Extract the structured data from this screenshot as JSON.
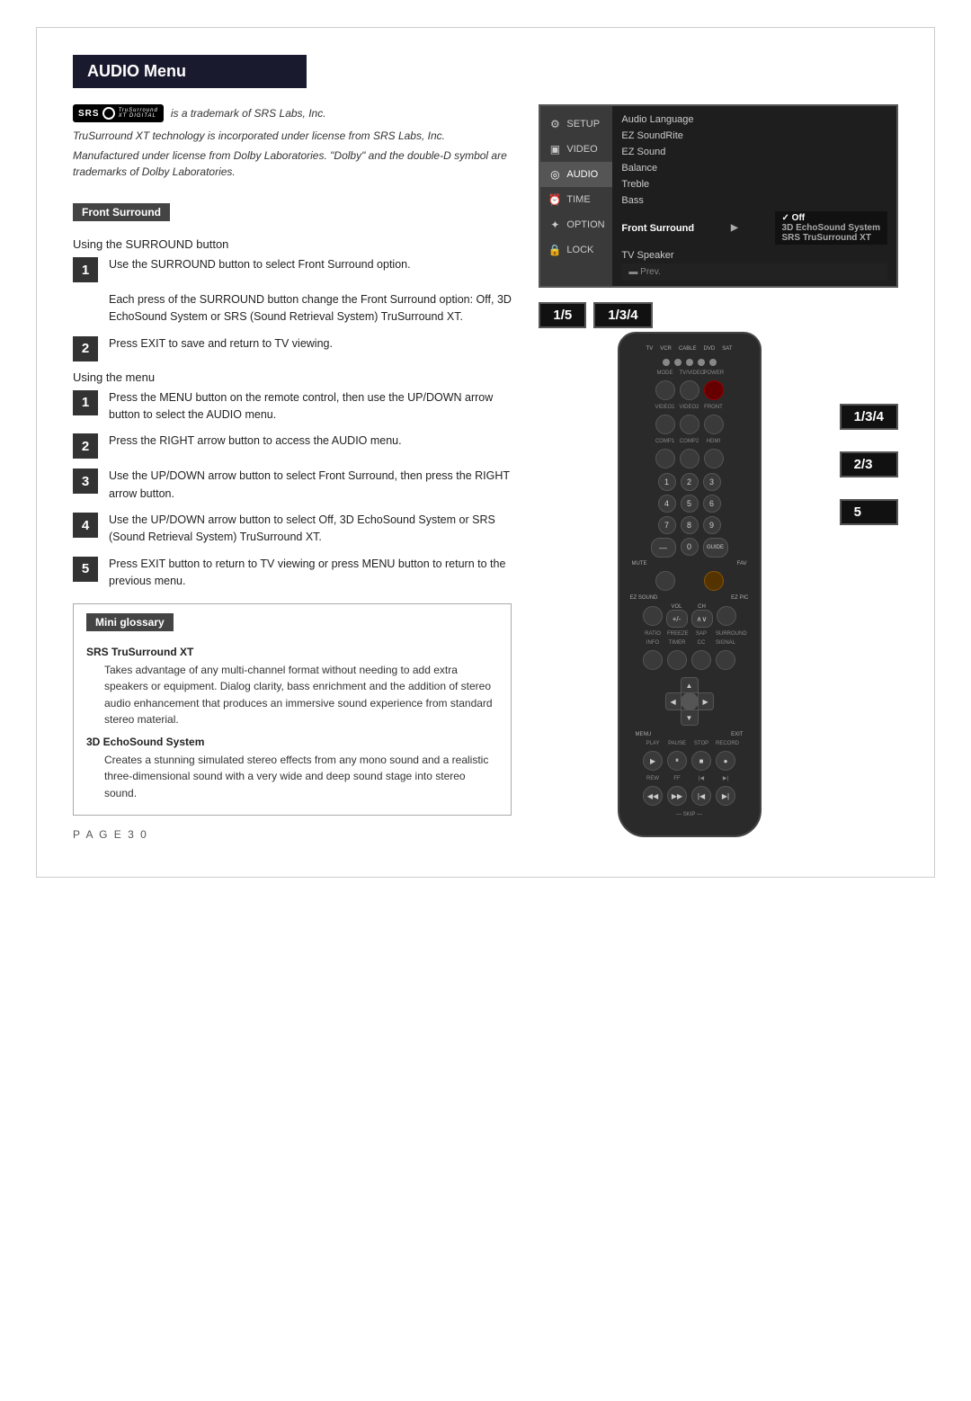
{
  "header": {
    "title": "AUDIO Menu"
  },
  "srs": {
    "trademark": "is a trademark of SRS Labs, Inc.",
    "desc1": "TruSurround XT technology is incorporated under license from SRS Labs, Inc.",
    "desc2": "Manufactured under license from Dolby Laboratories. \"Dolby\" and the double-D symbol are trademarks of Dolby Laboratories."
  },
  "front_surround_section": {
    "label": "Front Surround",
    "subtitle1": "Using the SURROUND button",
    "step1": "Use the SURROUND button to select Front Surround option.",
    "step1_detail": "Each press of the SURROUND button change the Front Surround option: Off, 3D EchoSound System or SRS (Sound Retrieval System) TruSurround XT.",
    "step2": "Press EXIT to save and return to TV viewing.",
    "subtitle2": "Using the menu",
    "menu_step1": "Press the MENU button on the remote control, then use the UP/DOWN arrow button to select the AUDIO menu.",
    "menu_step2": "Press the RIGHT arrow button to access the AUDIO menu.",
    "menu_step3": "Use the UP/DOWN arrow button to select Front Surround, then press the RIGHT arrow button.",
    "menu_step4": "Use the UP/DOWN arrow button to select Off, 3D EchoSound System or SRS (Sound Retrieval System) TruSurround XT.",
    "menu_step5": "Press EXIT button to return to TV viewing or press MENU button to return to the previous menu."
  },
  "glossary": {
    "label": "Mini glossary",
    "terms": [
      {
        "term": "SRS TruSurround XT",
        "def": "Takes advantage of any multi-channel format without needing to add extra speakers or equipment. Dialog clarity, bass enrichment and the addition of stereo audio enhancement that produces an immersive sound experience from standard stereo material."
      },
      {
        "term": "3D EchoSound System",
        "def": "Creates a stunning simulated stereo effects from any mono sound and a realistic three-dimensional sound with a very wide and deep sound stage into stereo sound."
      }
    ]
  },
  "page_number": "P A G E   3 0",
  "menu": {
    "items": [
      {
        "label": "SETUP",
        "icon": "⚙"
      },
      {
        "label": "VIDEO",
        "icon": "▣"
      },
      {
        "label": "AUDIO",
        "icon": "◎",
        "active": true
      },
      {
        "label": "TIME",
        "icon": "⏰"
      },
      {
        "label": "OPTION",
        "icon": "✦"
      },
      {
        "label": "LOCK",
        "icon": "🔒"
      }
    ],
    "content_items": [
      {
        "label": "Audio Language"
      },
      {
        "label": "EZ SoundRite"
      },
      {
        "label": "EZ Sound"
      },
      {
        "label": "Balance"
      },
      {
        "label": "Treble"
      },
      {
        "label": "Bass"
      },
      {
        "label": "Front Surround",
        "has_arrow": true,
        "selected": true
      },
      {
        "label": "TV Speaker"
      }
    ],
    "submenu_items": [
      {
        "label": "✓ Off",
        "checked": true
      },
      {
        "label": "3D EchoSound System"
      },
      {
        "label": "SRS TruSurround XT"
      }
    ],
    "prev_label": "▬ Prev."
  },
  "badges": {
    "right_top": "1/3/4",
    "right_mid": "2/3",
    "right_bot": "5",
    "bottom_left1": "1/5",
    "bottom_left2": "1/3/4"
  }
}
